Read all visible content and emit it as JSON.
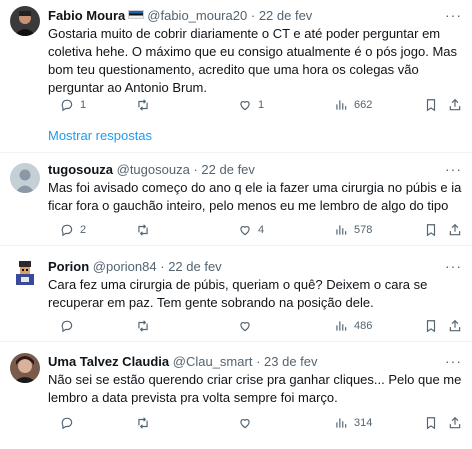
{
  "tweets": [
    {
      "name": "Fabio Moura",
      "handle": "@fabio_moura20",
      "date": "22 de fev",
      "text": "Gostaria muito de cobrir diariamente o CT e até poder perguntar em coletiva hehe. O máximo que eu consigo atualmente é o pós jogo. Mas bom teu questionamento, acredito que uma hora os colegas vão perguntar ao Antonio Brum.",
      "replies": "1",
      "retweets": "",
      "likes": "1",
      "views": "662"
    },
    {
      "name": "tugosouza",
      "handle": "@tugosouza",
      "date": "22 de fev",
      "text": "Mas foi avisado começo do ano q ele ia fazer uma cirurgia no púbis e ia ficar fora o gauchão inteiro, pelo menos eu me lembro de algo do tipo",
      "replies": "2",
      "retweets": "",
      "likes": "4",
      "views": "578"
    },
    {
      "name": "Porion",
      "handle": "@porion84",
      "date": "22 de fev",
      "text": "Cara fez uma cirurgia de púbis, queriam o quê? Deixem o cara se recuperar em paz. Tem gente sobrando na posição dele.",
      "replies": "",
      "retweets": "",
      "likes": "",
      "views": "486"
    },
    {
      "name": "Uma Talvez Claudia",
      "handle": "@Clau_smart",
      "date": "23 de fev",
      "text": "Não sei se estão querendo criar crise pra ganhar cliques... Pelo que me lembro a data prevista pra volta sempre foi março.",
      "replies": "",
      "retweets": "",
      "likes": "",
      "views": "314"
    }
  ],
  "show_replies_label": "Mostrar respostas",
  "separator": "·",
  "more_glyph": "···",
  "colors": {
    "accent": "#1d9bf0",
    "secondary_text": "#536471",
    "divider": "#eff3f4"
  },
  "icons": [
    "reply-icon",
    "retweet-icon",
    "like-icon",
    "views-icon",
    "bookmark-icon",
    "share-icon",
    "more-icon"
  ]
}
